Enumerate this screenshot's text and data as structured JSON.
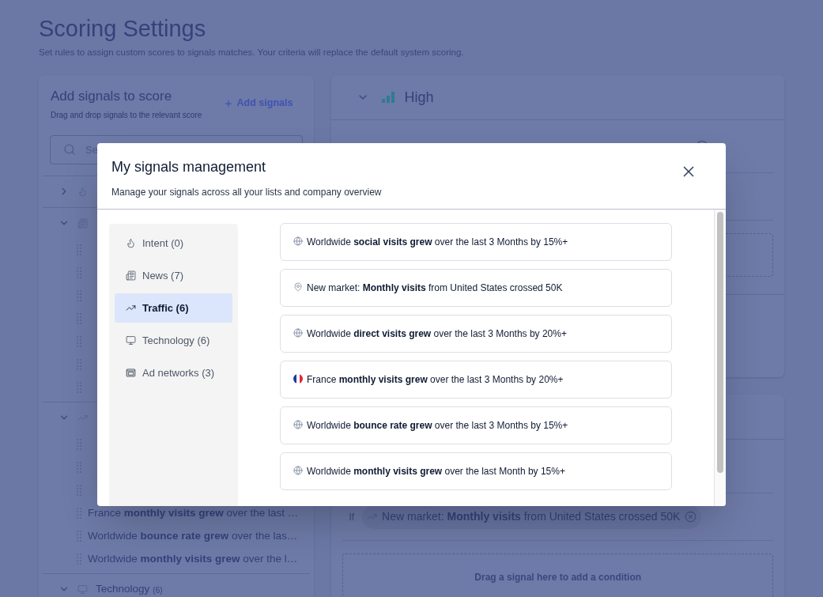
{
  "page": {
    "title": "Scoring Settings",
    "subtitle": "Set rules to assign custom scores to signals matches. Your criteria will replace the default system scoring."
  },
  "signals_panel": {
    "title": "Add signals to score",
    "subtitle": "Drag and drop signals to the relevant score",
    "add_link": "Add signals",
    "search": {
      "placeholder": "Se"
    },
    "groups": [
      {
        "kind": "intent",
        "expanded": false
      },
      {
        "kind": "news",
        "expanded": true,
        "children": [
          {
            "kind": "covered"
          },
          {
            "kind": "covered"
          },
          {
            "kind": "covered"
          },
          {
            "kind": "covered"
          },
          {
            "kind": "covered"
          },
          {
            "kind": "covered"
          },
          {
            "kind": "covered"
          }
        ]
      },
      {
        "kind": "traffic",
        "expanded": true,
        "children": [
          {
            "kind": "covered"
          },
          {
            "kind": "covered"
          },
          {
            "kind": "covered"
          },
          {
            "kind": "text",
            "text": "France **monthly visits grew** over the last …"
          },
          {
            "kind": "text",
            "text": "Worldwide **bounce rate grew** over the las…"
          },
          {
            "kind": "text",
            "text": "Worldwide **monthly visits grew** over the l…"
          }
        ]
      },
      {
        "kind": "technology",
        "label": "Technology",
        "count": "(6)",
        "expanded": true
      }
    ]
  },
  "score_cards": [
    {
      "title": "High",
      "kind": "high"
    },
    {
      "condition": {
        "prefix": "If",
        "text": "New market: **Monthly visits** from United States crossed 50K"
      },
      "dropzone": "Drag a signal here to add a condition"
    }
  ],
  "modal": {
    "title": "My signals management",
    "subtitle": "Manage your signals across all your lists and company overview",
    "categories": [
      {
        "kind": "intent",
        "label": "Intent (0)",
        "selected": false
      },
      {
        "kind": "news",
        "label": "News (7)",
        "selected": false
      },
      {
        "kind": "traffic",
        "label": "Traffic (6)",
        "selected": true
      },
      {
        "kind": "technology",
        "label": "Technology (6)",
        "selected": false
      },
      {
        "kind": "ad",
        "label": "Ad networks (3)",
        "selected": false
      }
    ],
    "signals": [
      {
        "kind": "globe",
        "text": "Worldwide **social visits grew** over the last 3 Months by 15%+"
      },
      {
        "kind": "pin",
        "text": "New market: **Monthly visits** from United States crossed 50K"
      },
      {
        "kind": "globe",
        "text": "Worldwide **direct visits grew** over the last 3 Months by 20%+"
      },
      {
        "kind": "flag",
        "text": "France **monthly visits grew** over the last 3 Months by 20%+"
      },
      {
        "kind": "globe",
        "text": "Worldwide **bounce rate grew** over the last 3 Months by 15%+"
      },
      {
        "kind": "globe",
        "text": "Worldwide **monthly visits grew** over the last Month by 15%+"
      }
    ]
  }
}
